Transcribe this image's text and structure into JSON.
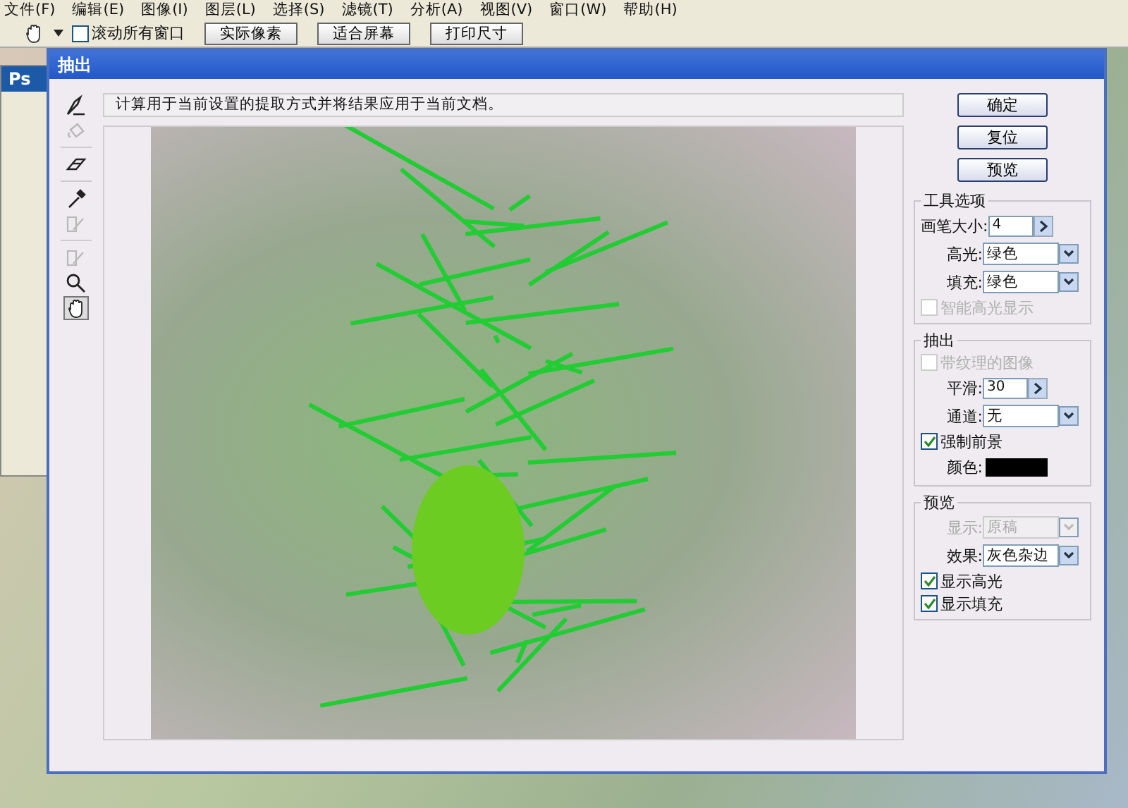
{
  "menu": [
    "文件(F)",
    "编辑(E)",
    "图像(I)",
    "图层(L)",
    "选择(S)",
    "滤镜(T)",
    "分析(A)",
    "视图(V)",
    "窗口(W)",
    "帮助(H)"
  ],
  "options_bar": {
    "scroll_all": {
      "label": "滚动所有窗口",
      "checked": false
    },
    "buttons": [
      "实际像素",
      "适合屏幕",
      "打印尺寸"
    ]
  },
  "toolbox": {
    "logo": "Ps"
  },
  "dialog": {
    "title": "抽出",
    "hint": "计算用于当前设置的提取方式并将结果应用于当前文档。",
    "tools": [
      {
        "selected": false,
        "disabled": false
      },
      {
        "selected": false,
        "disabled": true
      },
      {
        "selected": false,
        "disabled": false
      },
      {
        "selected": false,
        "disabled": false
      },
      {
        "selected": false,
        "disabled": true
      },
      {
        "selected": false,
        "disabled": true
      },
      {
        "selected": false,
        "disabled": false
      },
      {
        "selected": true,
        "disabled": false
      }
    ],
    "buttons": [
      "确定",
      "复位",
      "预览"
    ],
    "tool_options": {
      "title": "工具选项",
      "brush_size": {
        "label": "画笔大小:",
        "value": "4"
      },
      "highlight": {
        "label": "高光:",
        "value": "绿色"
      },
      "fill": {
        "label": "填充:",
        "value": "绿色"
      },
      "smart_highlighting": {
        "label": "智能高光显示",
        "checked": false,
        "disabled": true
      }
    },
    "extraction": {
      "title": "抽出",
      "textured_image": {
        "label": "带纹理的图像",
        "checked": false,
        "disabled": true
      },
      "smooth": {
        "label": "平滑:",
        "value": "30"
      },
      "channel": {
        "label": "通道:",
        "value": "无"
      },
      "force_foreground": {
        "label": "强制前景",
        "checked": true,
        "disabled": false
      },
      "color_label": "颜色:"
    },
    "preview": {
      "title": "预览",
      "show": {
        "label": "显示:",
        "value": "原稿",
        "disabled": true
      },
      "effect": {
        "label": "效果:",
        "value": "灰色杂边",
        "disabled": false
      },
      "show_highlight": {
        "label": "显示高光",
        "checked": true,
        "disabled": false
      },
      "show_fill": {
        "label": "显示填充",
        "checked": true,
        "disabled": false
      }
    }
  }
}
